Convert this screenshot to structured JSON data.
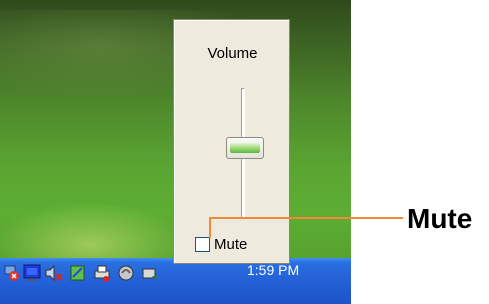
{
  "volume_popup": {
    "title": "Volume",
    "mute_label": "Mute",
    "mute_checked": false,
    "volume_level_fraction": 0.45
  },
  "callout": {
    "label": "Mute",
    "color": "#f08a3a"
  },
  "taskbar": {
    "clock": "1:59 PM",
    "tray_icons": [
      "network-error-icon",
      "monitor-icon",
      "sound-mute-icon",
      "notepad-icon",
      "printer-icon",
      "antivirus-icon",
      "safely-remove-icon"
    ]
  },
  "colors": {
    "taskbar": "#235fd6",
    "popup_bg": "#eeeadd",
    "checkbox_border": "#1c5180"
  }
}
